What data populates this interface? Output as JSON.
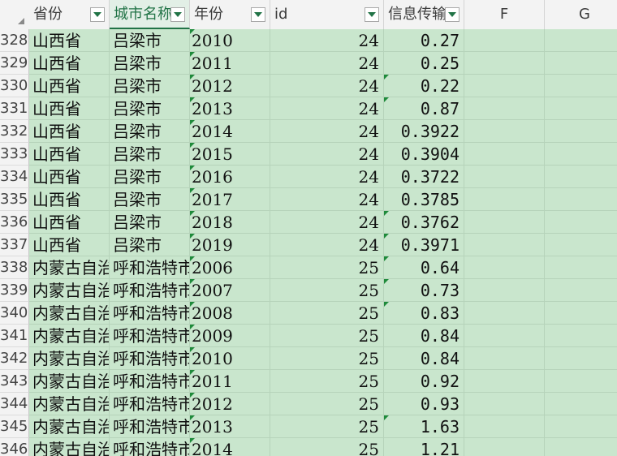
{
  "columns": [
    {
      "key": "A",
      "label": "省份",
      "filter": true
    },
    {
      "key": "B",
      "label": "城市名称",
      "filter": true,
      "active": true
    },
    {
      "key": "C",
      "label": "年份",
      "filter": true
    },
    {
      "key": "D",
      "label": "id",
      "filter": true
    },
    {
      "key": "E",
      "label": "信息传输",
      "filter": true
    },
    {
      "key": "F",
      "label": "F",
      "filter": false
    },
    {
      "key": "G",
      "label": "G",
      "filter": false
    }
  ],
  "rows": [
    {
      "num": "328",
      "province": "山西省",
      "city": "吕梁市",
      "year": "2010",
      "id": "24",
      "value": "0.27"
    },
    {
      "num": "329",
      "province": "山西省",
      "city": "吕梁市",
      "year": "2011",
      "id": "24",
      "value": "0.25"
    },
    {
      "num": "330",
      "province": "山西省",
      "city": "吕梁市",
      "year": "2012",
      "id": "24",
      "value": "0.22"
    },
    {
      "num": "331",
      "province": "山西省",
      "city": "吕梁市",
      "year": "2013",
      "id": "24",
      "value": "0.87"
    },
    {
      "num": "332",
      "province": "山西省",
      "city": "吕梁市",
      "year": "2014",
      "id": "24",
      "value": "0.3922"
    },
    {
      "num": "333",
      "province": "山西省",
      "city": "吕梁市",
      "year": "2015",
      "id": "24",
      "value": "0.3904"
    },
    {
      "num": "334",
      "province": "山西省",
      "city": "吕梁市",
      "year": "2016",
      "id": "24",
      "value": "0.3722"
    },
    {
      "num": "335",
      "province": "山西省",
      "city": "吕梁市",
      "year": "2017",
      "id": "24",
      "value": "0.3785"
    },
    {
      "num": "336",
      "province": "山西省",
      "city": "吕梁市",
      "year": "2018",
      "id": "24",
      "value": "0.3762"
    },
    {
      "num": "337",
      "province": "山西省",
      "city": "吕梁市",
      "year": "2019",
      "id": "24",
      "value": "0.3971"
    },
    {
      "num": "338",
      "province": "内蒙古自治",
      "city": "呼和浩特市",
      "year": "2006",
      "id": "25",
      "value": "0.64"
    },
    {
      "num": "339",
      "province": "内蒙古自治",
      "city": "呼和浩特市",
      "year": "2007",
      "id": "25",
      "value": "0.73"
    },
    {
      "num": "340",
      "province": "内蒙古自治",
      "city": "呼和浩特市",
      "year": "2008",
      "id": "25",
      "value": "0.83"
    },
    {
      "num": "341",
      "province": "内蒙古自治",
      "city": "呼和浩特市",
      "year": "2009",
      "id": "25",
      "value": "0.84"
    },
    {
      "num": "342",
      "province": "内蒙古自治",
      "city": "呼和浩特市",
      "year": "2010",
      "id": "25",
      "value": "0.84"
    },
    {
      "num": "343",
      "province": "内蒙古自治",
      "city": "呼和浩特市",
      "year": "2011",
      "id": "25",
      "value": "0.92"
    },
    {
      "num": "344",
      "province": "内蒙古自治",
      "city": "呼和浩特市",
      "year": "2012",
      "id": "25",
      "value": "0.93"
    },
    {
      "num": "345",
      "province": "内蒙古自治",
      "city": "呼和浩特市",
      "year": "2013",
      "id": "25",
      "value": "1.63"
    },
    {
      "num": "346",
      "province": "内蒙古自治",
      "city": "呼和浩特市",
      "year": "2014",
      "id": "25",
      "value": "1.21"
    }
  ]
}
